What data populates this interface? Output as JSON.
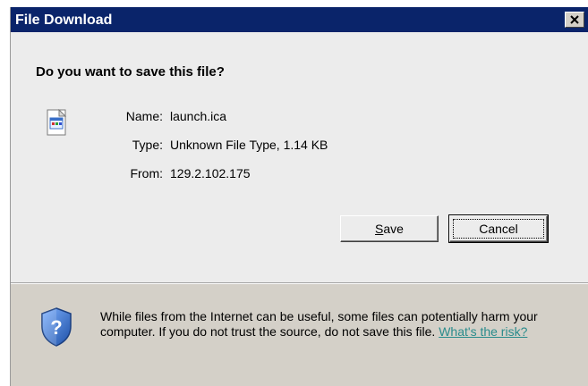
{
  "window": {
    "title": "File Download",
    "close_label": "×"
  },
  "dialog": {
    "question": "Do you want to save this file?",
    "file": {
      "name_label": "Name:",
      "name": "launch.ica",
      "type_label": "Type:",
      "type": "Unknown File Type, 1.14 KB",
      "from_label": "From:",
      "from": "129.2.102.175"
    },
    "buttons": {
      "save_prefix": "S",
      "save_rest": "ave",
      "cancel": "Cancel"
    },
    "warning": {
      "text": "While files from the Internet can be useful, some files can potentially harm your computer. If you do not trust the source, do not save this file. ",
      "link": "What's the risk?"
    }
  },
  "colors": {
    "titlebar": "#0a246a",
    "dialog_bg": "#ececec",
    "link": "#2a8c8c",
    "shield": "#2c5fb8"
  },
  "icons": [
    "close-icon",
    "file-icon",
    "shield-question-icon"
  ]
}
